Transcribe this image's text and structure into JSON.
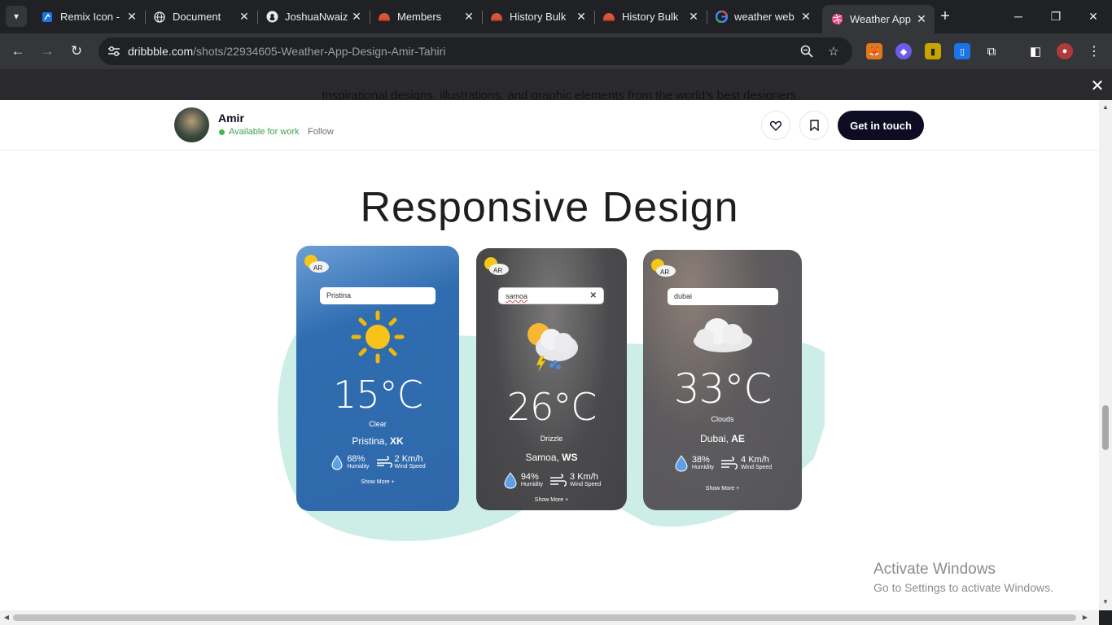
{
  "browser": {
    "tabs": [
      {
        "title": "Remix Icon -",
        "favicon": "remix-icon",
        "color": "#1a73e8"
      },
      {
        "title": "Document",
        "favicon": "globe-icon",
        "color": "#e8eaed"
      },
      {
        "title": "JoshuaNwaiz",
        "favicon": "github-icon",
        "color": "#e8eaed"
      },
      {
        "title": "Members",
        "favicon": "helmet-icon",
        "color": "#d8553a"
      },
      {
        "title": "History Bulk",
        "favicon": "helmet-icon",
        "color": "#d8553a"
      },
      {
        "title": "History Bulk",
        "favicon": "helmet-icon",
        "color": "#d8553a"
      },
      {
        "title": "weather web",
        "favicon": "google-icon",
        "color": "#4285f4"
      },
      {
        "title": "Weather App",
        "favicon": "dribbble-icon",
        "color": "#ea4c89"
      }
    ],
    "url_host": "dribbble.com",
    "url_path": "/shots/22934605-Weather-App-Design-Amir-Tahiri"
  },
  "page": {
    "tagline": "Inspirational designs, illustrations, and graphic elements from the world's best designers.",
    "author": "Amir",
    "availability": "Available for work",
    "follow": "Follow",
    "cta": "Get in touch",
    "heading": "Responsive Design",
    "accent": "#0d0c22",
    "blob_color": "#cdeee6"
  },
  "cards": [
    {
      "search": "Pristina",
      "temp": "15°C",
      "condition": "Clear",
      "city": "Pristina,",
      "country": "XK",
      "humidity": "68%",
      "humidity_label": "Humidity",
      "wind": "2 Km/h",
      "wind_label": "Wind Speed",
      "more": "Show More +",
      "icon": "sun-icon",
      "bg": "#2f6db0"
    },
    {
      "search": "samoa",
      "temp": "26°C",
      "condition": "Drizzle",
      "city": "Samoa,",
      "country": "WS",
      "humidity": "94%",
      "humidity_label": "Humidity",
      "wind": "3 Km/h",
      "wind_label": "Wind Speed",
      "more": "Show More +",
      "icon": "storm-cloud-icon",
      "bg": "#4a4a4c"
    },
    {
      "search": "dubai",
      "temp": "33°C",
      "condition": "Clouds",
      "city": "Dubai,",
      "country": "AE",
      "humidity": "38%",
      "humidity_label": "Humidity",
      "wind": "4 Km/h",
      "wind_label": "Wind Speed",
      "more": "Show More +",
      "icon": "cloud-icon",
      "bg": "#5d5b5d"
    }
  ],
  "watermark": {
    "line1": "Activate Windows",
    "line2": "Go to Settings to activate Windows."
  }
}
